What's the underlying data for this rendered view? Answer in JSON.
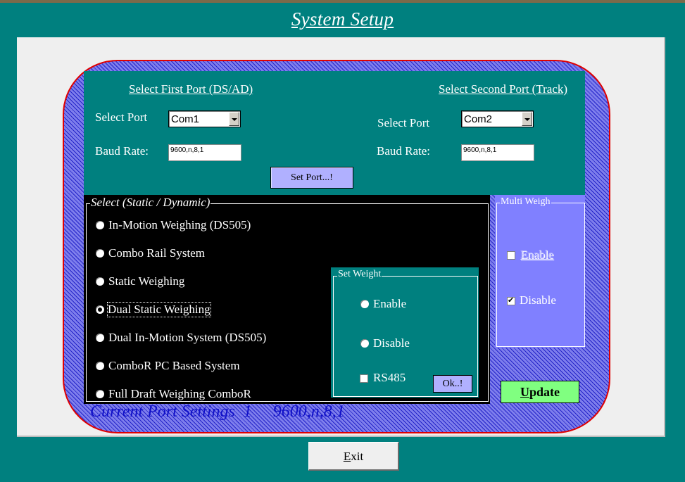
{
  "window": {
    "title": "System Setup"
  },
  "first_port": {
    "title": "Select First Port (DS/AD)",
    "select_port_label": "Select Port",
    "port_value": "Com1",
    "baud_label": "Baud Rate:",
    "baud_value": "9600,n,8,1"
  },
  "second_port": {
    "title": "Select Second Port (Track)",
    "select_port_label": "Select Port",
    "port_value": "Com2",
    "baud_label": "Baud Rate:",
    "baud_value": "9600,n,8,1"
  },
  "set_port_button": "Set Port...!",
  "mode_select": {
    "legend": "Select (Static / Dynamic)",
    "options": [
      {
        "label": "In-Motion Weighing (DS505)",
        "selected": false
      },
      {
        "label": "Combo Rail System",
        "selected": false
      },
      {
        "label": "Static Weighing",
        "selected": false
      },
      {
        "label": "Dual Static Weighing",
        "selected": true
      },
      {
        "label": "Dual In-Motion System (DS505)",
        "selected": false
      },
      {
        "label": "ComboR PC Based System",
        "selected": false
      },
      {
        "label": "Full Draft Weighing ComboR",
        "selected": false
      }
    ]
  },
  "set_weight": {
    "legend": "Set Weight",
    "enable_label": "Enable",
    "disable_label": "Disable",
    "rs485_label": "RS485",
    "ok_button": "Ok..!"
  },
  "multi_weigh": {
    "legend": "Multi Weigh",
    "enable_label": "Enable",
    "enable_checked": false,
    "disable_label": "Disable",
    "disable_checked": true
  },
  "update_button": {
    "accel": "U",
    "rest": "pdate"
  },
  "current_port_settings": "Current Port Settings  1     9600,n,8,1",
  "exit_button": {
    "accel": "E",
    "rest": "xit"
  },
  "colors": {
    "background": "#00807f",
    "canvas": "#efefef",
    "hatch_fill": "#7e7eec",
    "frame_border": "#e00000",
    "button_blue": "#b0b0ff",
    "update_green": "#80ff80",
    "status_text": "#1010c8",
    "multi_weigh_panel": "#8080ff"
  }
}
